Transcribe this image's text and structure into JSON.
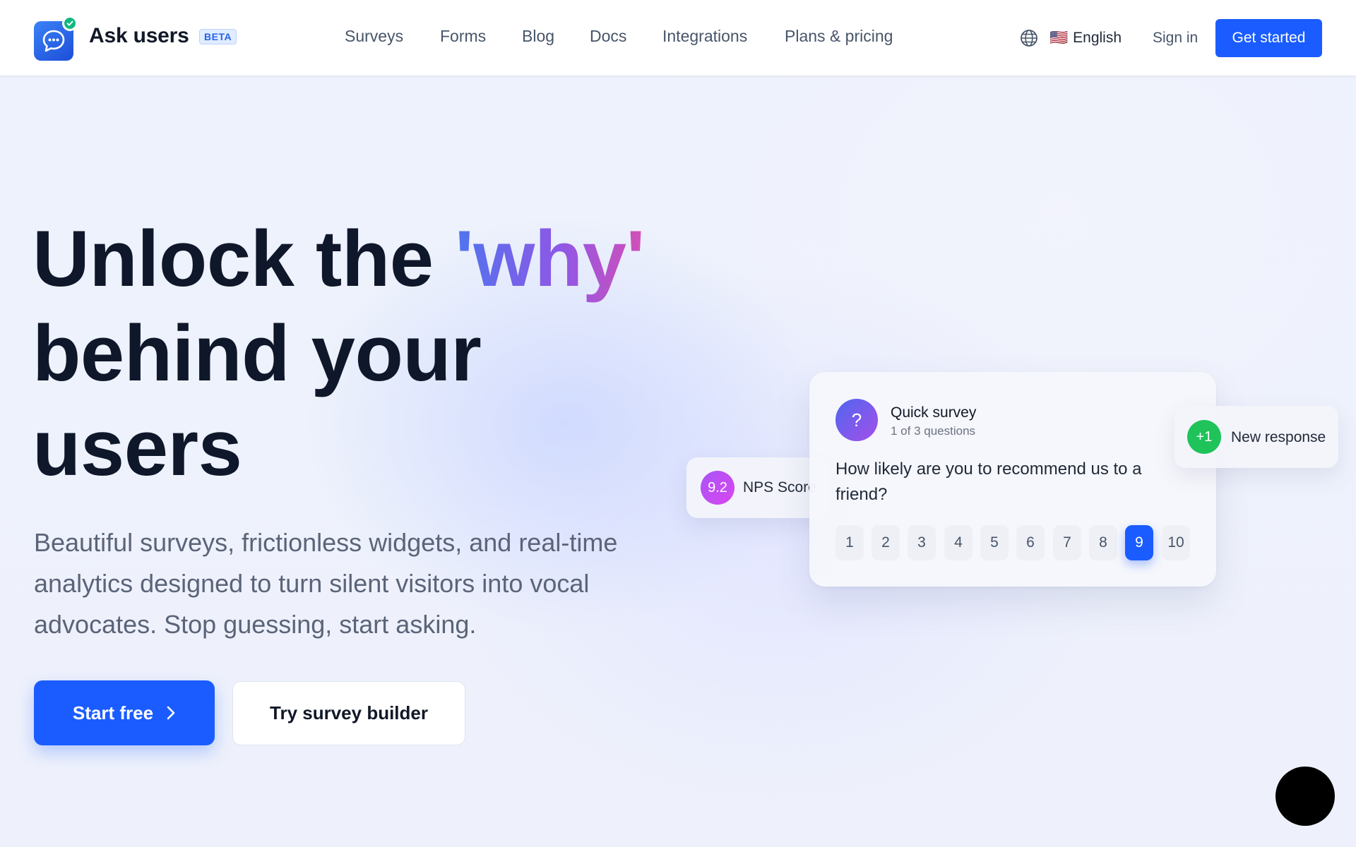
{
  "brand": {
    "name": "Ask users",
    "badge": "BETA"
  },
  "nav": {
    "items": [
      {
        "label": "Surveys"
      },
      {
        "label": "Forms"
      },
      {
        "label": "Blog"
      },
      {
        "label": "Docs"
      },
      {
        "label": "Integrations"
      },
      {
        "label": "Plans & pricing"
      }
    ],
    "language": {
      "flag": "🇺🇸",
      "label": "English",
      "icon": "globe-icon"
    },
    "signin_label": "Sign in",
    "cta_label": "Get started"
  },
  "hero": {
    "headline_before": "Unlock the ",
    "headline_accent": "'why'",
    "headline_after": "behind your users",
    "subtext": "Beautiful surveys, frictionless widgets, and real-time analytics designed to turn silent visitors into vocal advocates. Stop guessing, start asking.",
    "primary_button": "Start free",
    "secondary_button": "Try survey builder"
  },
  "survey_card": {
    "icon": "?",
    "title": "Quick survey",
    "subtitle": "1 of 3 questions",
    "question": "How likely are you to recommend us to a friend?",
    "scale": [
      "1",
      "2",
      "3",
      "4",
      "5",
      "6",
      "7",
      "8",
      "9",
      "10"
    ],
    "selected": "9"
  },
  "nps_badge": {
    "value": "9.2",
    "label": "NPS Score"
  },
  "response_badge": {
    "value": "+1",
    "label": "New response"
  },
  "chat_widget": {
    "icon": "chat-icon",
    "glyph": ""
  },
  "colors": {
    "primary": "#1a5cff",
    "accent_gradient_start": "#4f74ee",
    "accent_gradient_end": "#d44fb7",
    "nps": "#a855f7",
    "response": "#1fc35a"
  }
}
